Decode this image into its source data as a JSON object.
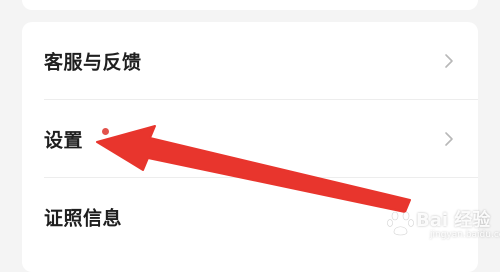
{
  "menu": {
    "items": [
      {
        "label": "客服与反馈",
        "chevron_icon": "chevron-right-icon"
      },
      {
        "label": "设置",
        "chevron_icon": "chevron-right-icon",
        "has_notification_dot": true
      },
      {
        "label": "证照信息",
        "chevron_icon": "chevron-right-icon"
      }
    ]
  },
  "annotation": {
    "arrow_color": "#e8352d",
    "arrow_icon": "red-arrow-annotation"
  },
  "watermark": {
    "text": "Bai 经验",
    "subtext": "jingyan.baidu.com",
    "icon": "baidu-paw-logo"
  },
  "colors": {
    "background": "#f4f4f4",
    "card": "#ffffff",
    "notification_dot": "#e2524c",
    "chevron": "#b8b8b8",
    "text": "#1f1f1f"
  }
}
